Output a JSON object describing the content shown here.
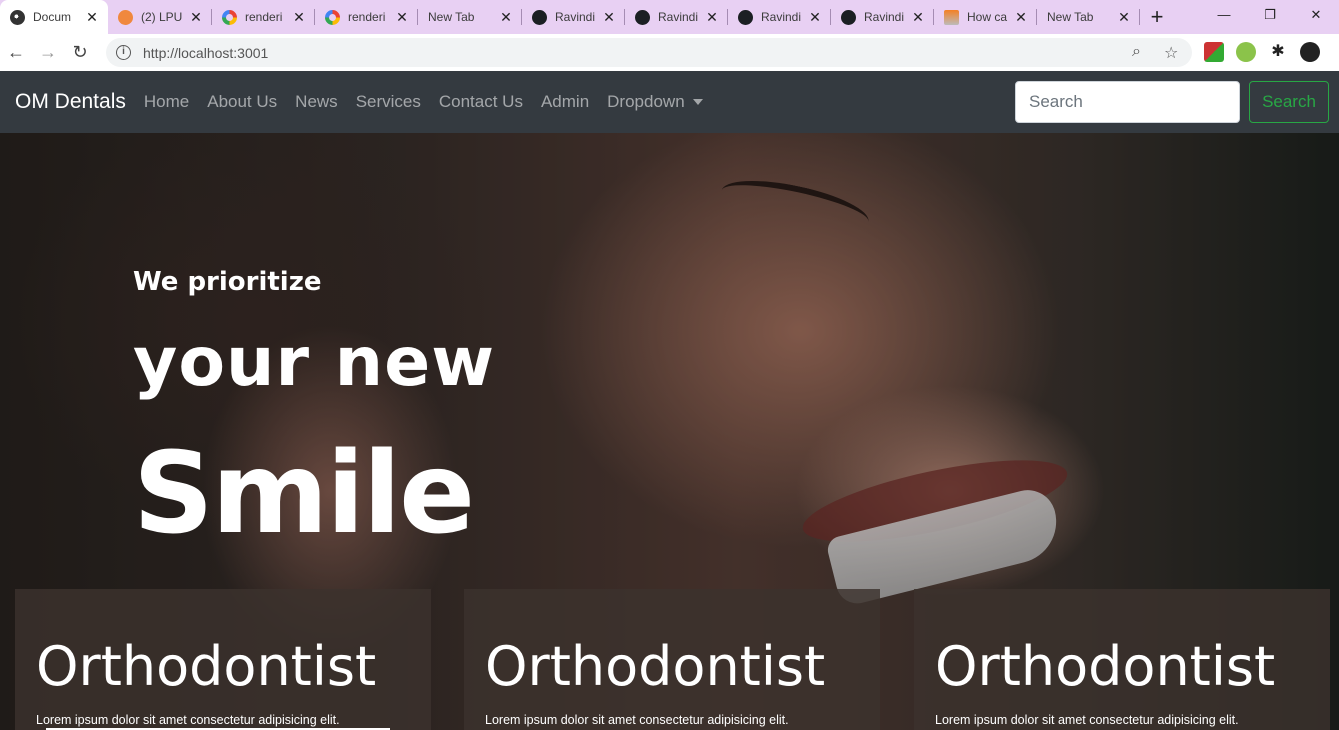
{
  "browser": {
    "tabs": [
      {
        "title": "Docum",
        "icon": "globe-icon",
        "active": true
      },
      {
        "title": "(2) LPU",
        "icon": "lpu-icon",
        "active": false
      },
      {
        "title": "renderi",
        "icon": "google-icon",
        "active": false
      },
      {
        "title": "renderi",
        "icon": "google-icon",
        "active": false
      },
      {
        "title": "New Tab",
        "icon": "",
        "active": false
      },
      {
        "title": "Ravindi",
        "icon": "github-icon",
        "active": false
      },
      {
        "title": "Ravindi",
        "icon": "github-icon",
        "active": false
      },
      {
        "title": "Ravindi",
        "icon": "github-icon",
        "active": false
      },
      {
        "title": "Ravindi",
        "icon": "github-icon",
        "active": false
      },
      {
        "title": "How ca",
        "icon": "stackoverflow-icon",
        "active": false
      },
      {
        "title": "New Tab",
        "icon": "",
        "active": false
      }
    ],
    "url": "http://localhost:3001"
  },
  "navbar": {
    "brand": "OM Dentals",
    "links": [
      "Home",
      "About Us",
      "News",
      "Services",
      "Contact Us",
      "Admin",
      "Dropdown"
    ],
    "search_placeholder": "Search",
    "search_button": "Search"
  },
  "hero": {
    "line1": "We prioritize",
    "line2": "your new",
    "line3": "Smile"
  },
  "cards": [
    {
      "title": "Orthodontist",
      "text": "Lorem ipsum dolor sit amet consectetur adipisicing elit."
    },
    {
      "title": "Orthodontist",
      "text": "Lorem ipsum dolor sit amet consectetur adipisicing elit."
    },
    {
      "title": "Orthodontist",
      "text": "Lorem ipsum dolor sit amet consectetur adipisicing elit."
    }
  ],
  "colors": {
    "navbar_bg": "#343a40",
    "search_green": "#28a745",
    "tabbar_bg": "#e8d0f3"
  }
}
